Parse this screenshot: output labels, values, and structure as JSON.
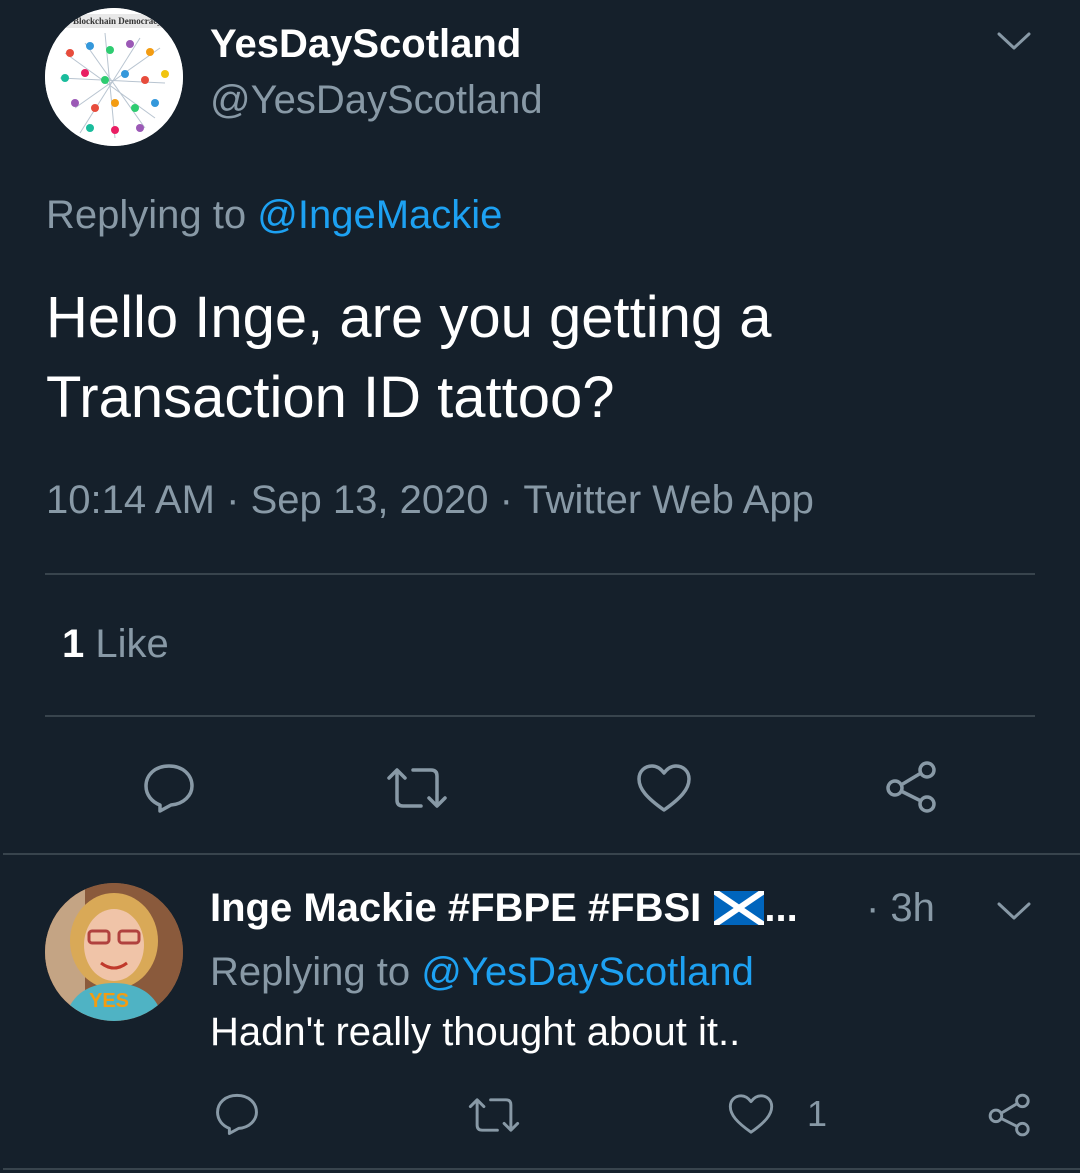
{
  "main_tweet": {
    "display_name": "YesDayScotland",
    "handle": "@YesDayScotland",
    "avatar_logo_text": "Blockchain Democracy",
    "replying_prefix": "Replying to ",
    "replying_to": "@IngeMackie",
    "text": "Hello Inge, are you getting a Transaction ID tattoo?",
    "time": "10:14 AM",
    "separator": " · ",
    "date": "Sep 13, 2020",
    "source": "Twitter Web App",
    "like_count": "1",
    "like_label": "Like"
  },
  "reply_tweet": {
    "display_name": "Inge Mackie #FBPE #FBSI",
    "ellipsis": "...",
    "flag": "🏴",
    "time": "· 3h",
    "replying_prefix": "Replying to ",
    "replying_to": "@YesDayScotland",
    "text": "Hadn't really thought about it..",
    "like_count": "1",
    "avatar_shirt_text": "YES"
  },
  "colors": {
    "background": "#15202b",
    "text": "#ffffff",
    "muted": "#8899a6",
    "link": "#1da1f2",
    "divider": "#38444d"
  },
  "icons": [
    "chevron-down-icon",
    "reply-icon",
    "retweet-icon",
    "like-icon",
    "share-icon",
    "saltire-flag-icon"
  ]
}
